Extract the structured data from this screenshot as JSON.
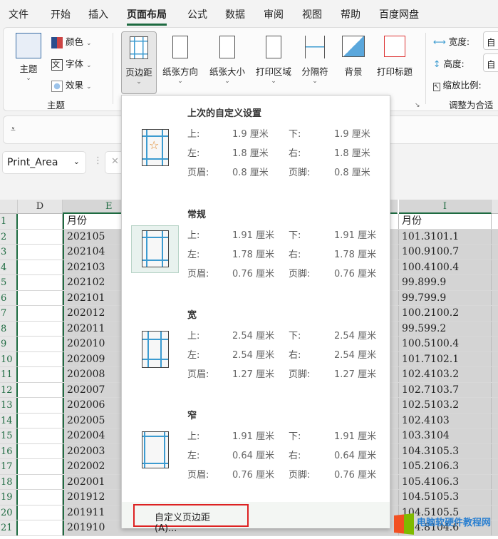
{
  "tabs": [
    "文件",
    "开始",
    "插入",
    "页面布局",
    "公式",
    "数据",
    "审阅",
    "视图",
    "帮助",
    "百度网盘"
  ],
  "active_tab": "页面布局",
  "ribbon": {
    "theme_group": {
      "theme": "主题",
      "colors": "颜色",
      "fonts": "字体",
      "effects": "效果",
      "group_label": "主题"
    },
    "page_setup": [
      "页边距",
      "纸张方向",
      "纸张大小",
      "打印区域",
      "分隔符",
      "背景",
      "打印标题"
    ],
    "scale": {
      "width": "宽度:",
      "height": "高度:",
      "scale": "缩放比例:",
      "group_label": "调整为合适",
      "width_value": "自",
      "height_value": "自"
    }
  },
  "name_box": "Print_Area",
  "columns": [
    "D",
    "E",
    "I"
  ],
  "rows": [
    {
      "n": "1",
      "e": "月份",
      "i": "月份"
    },
    {
      "n": "2",
      "e": "202105",
      "i": "101.3101.1"
    },
    {
      "n": "3",
      "e": "202104",
      "i": "100.9100.7"
    },
    {
      "n": "4",
      "e": "202103",
      "i": "100.4100.4"
    },
    {
      "n": "5",
      "e": "202102",
      "i": "99.899.9"
    },
    {
      "n": "6",
      "e": "202101",
      "i": "99.799.9"
    },
    {
      "n": "7",
      "e": "202012",
      "i": "100.2100.2"
    },
    {
      "n": "8",
      "e": "202011",
      "i": "99.599.2"
    },
    {
      "n": "9",
      "e": "202010",
      "i": "100.5100.4"
    },
    {
      "n": "10",
      "e": "202009",
      "i": "101.7102.1"
    },
    {
      "n": "11",
      "e": "202008",
      "i": "102.4103.2"
    },
    {
      "n": "12",
      "e": "202007",
      "i": "102.7103.7"
    },
    {
      "n": "13",
      "e": "202006",
      "i": "102.5103.2"
    },
    {
      "n": "14",
      "e": "202005",
      "i": "102.4103"
    },
    {
      "n": "15",
      "e": "202004",
      "i": "103.3104"
    },
    {
      "n": "16",
      "e": "202003",
      "i": "104.3105.3"
    },
    {
      "n": "17",
      "e": "202002",
      "i": "105.2106.3"
    },
    {
      "n": "18",
      "e": "202001",
      "i": "105.4106.3"
    },
    {
      "n": "19",
      "e": "201912",
      "i": "104.5105.3"
    },
    {
      "n": "20",
      "e": "201911",
      "i": "104.5105.5"
    },
    {
      "n": "21",
      "e": "201910",
      "i": "104.8104.6"
    }
  ],
  "margins_menu": {
    "presets": [
      {
        "title": "上次的自定义设置",
        "top": "1.9 厘米",
        "bottom": "1.9 厘米",
        "left": "1.8 厘米",
        "right": "1.8 厘米",
        "header": "0.8 厘米",
        "footer": "0.8 厘米"
      },
      {
        "title": "常规",
        "top": "1.91 厘米",
        "bottom": "1.91 厘米",
        "left": "1.78 厘米",
        "right": "1.78 厘米",
        "header": "0.76 厘米",
        "footer": "0.76 厘米"
      },
      {
        "title": "宽",
        "top": "2.54 厘米",
        "bottom": "2.54 厘米",
        "left": "2.54 厘米",
        "right": "2.54 厘米",
        "header": "1.27 厘米",
        "footer": "1.27 厘米"
      },
      {
        "title": "窄",
        "top": "1.91 厘米",
        "bottom": "1.91 厘米",
        "left": "0.64 厘米",
        "right": "0.64 厘米",
        "header": "0.76 厘米",
        "footer": "0.76 厘米"
      }
    ],
    "labels": {
      "top": "上:",
      "bottom": "下:",
      "left": "左:",
      "right": "右:",
      "header": "页眉:",
      "footer": "页脚:"
    },
    "custom": "自定义页边距(A)..."
  },
  "watermark": "电脑软硬件教程网"
}
